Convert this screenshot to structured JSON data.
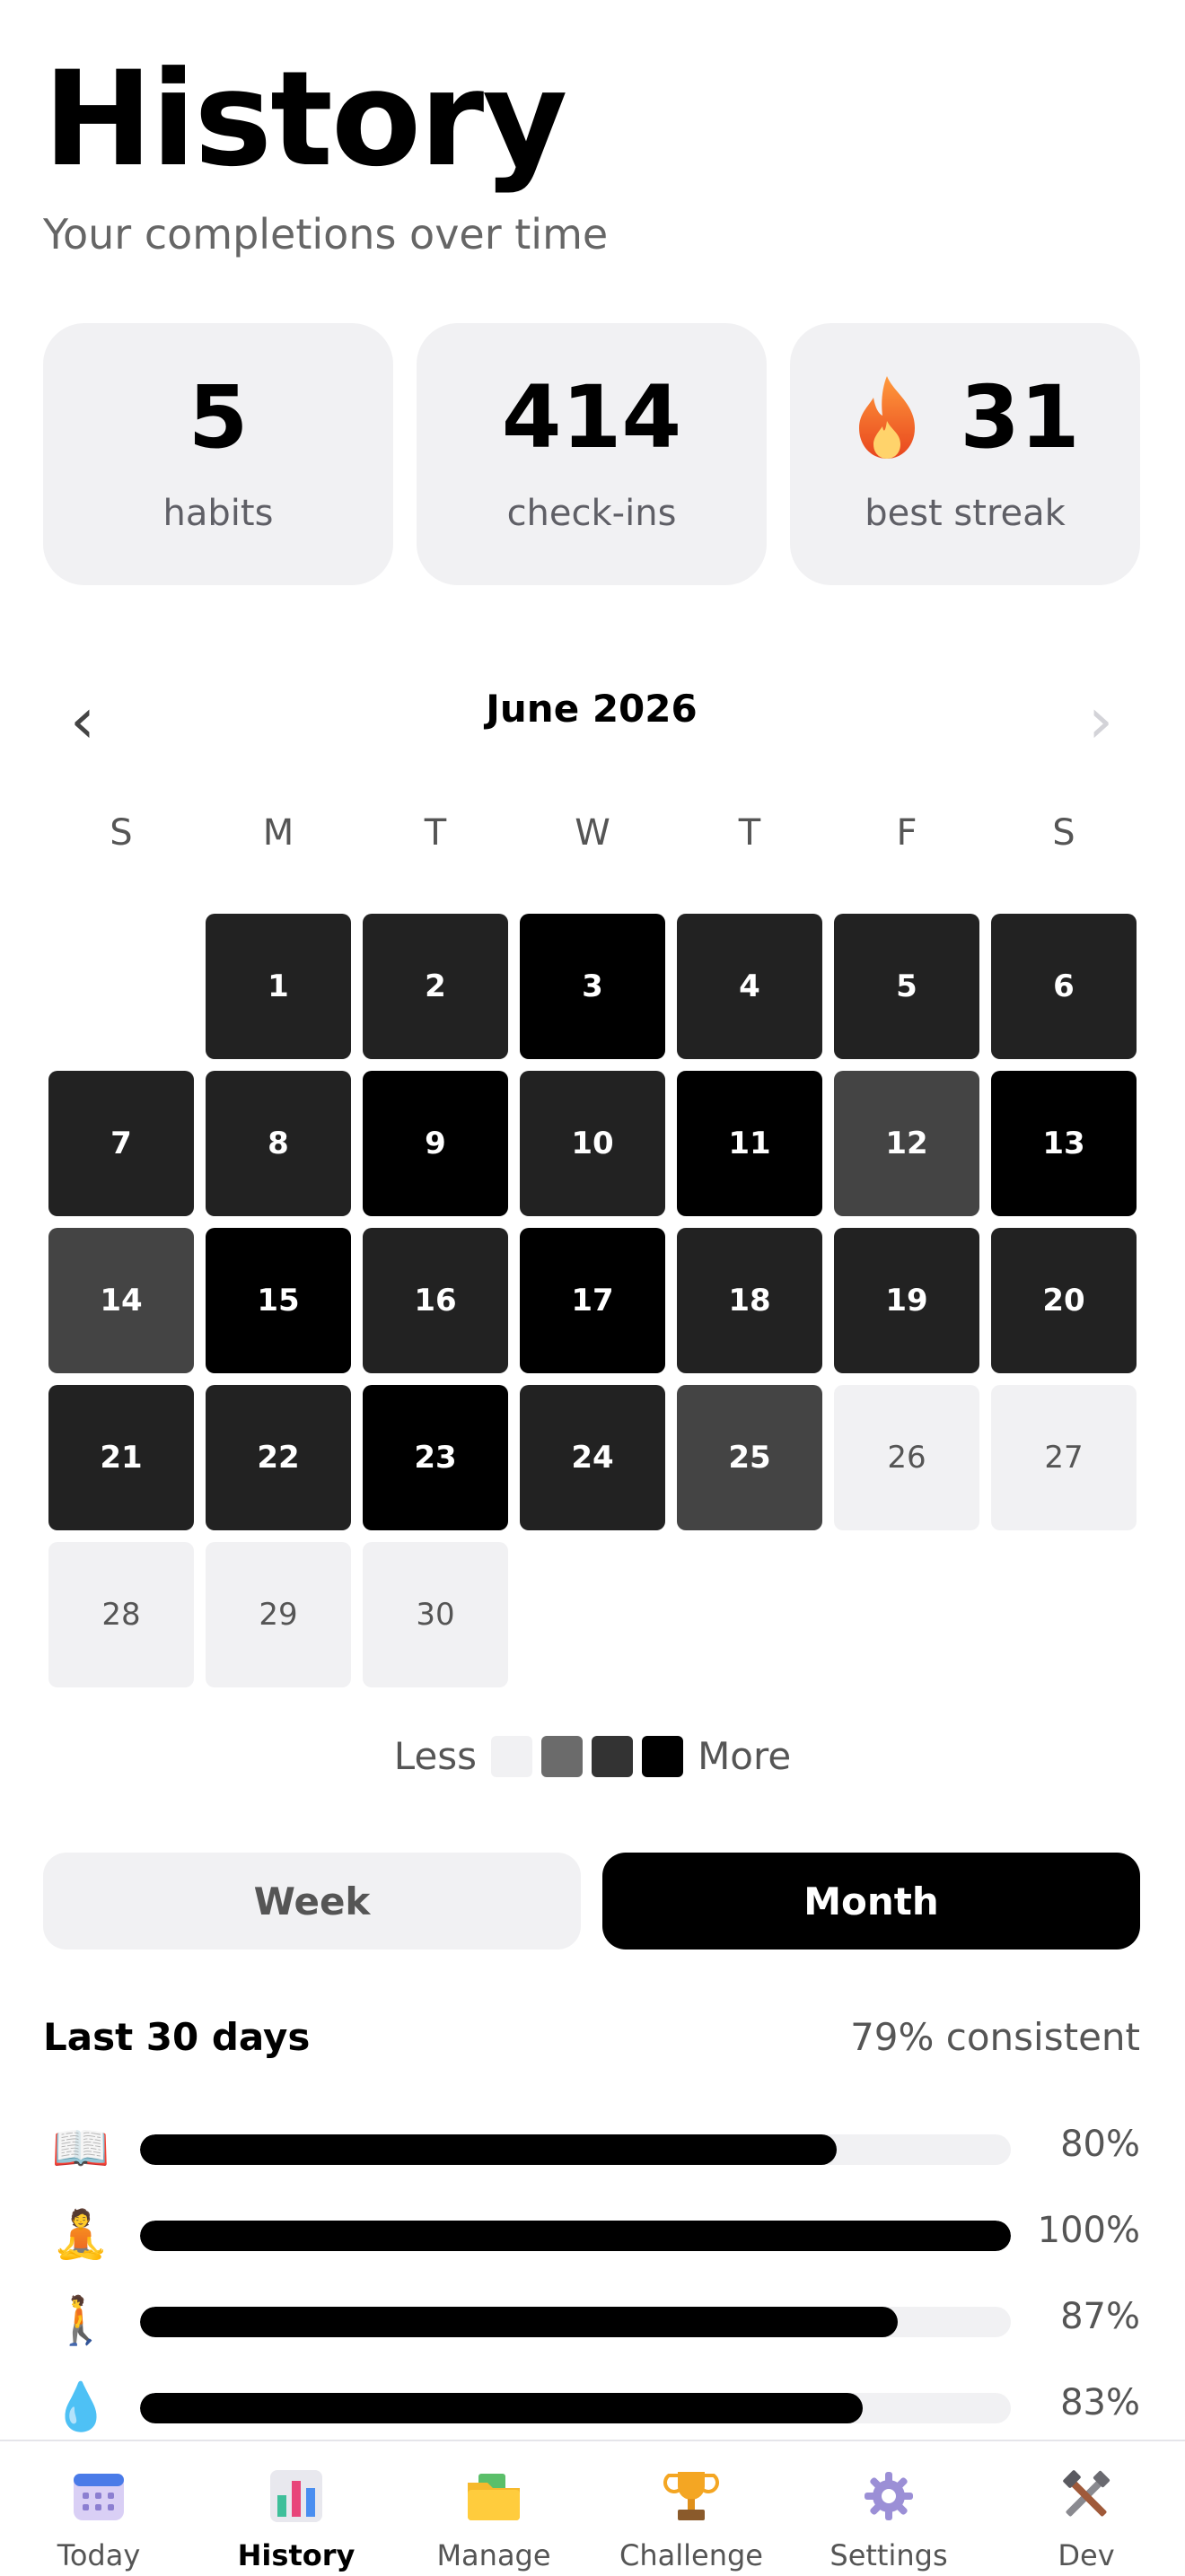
{
  "header": {
    "title": "History",
    "subtitle": "Your completions over time"
  },
  "stats": [
    {
      "value": "5",
      "label": "habits"
    },
    {
      "value": "414",
      "label": "check-ins"
    },
    {
      "value": "31",
      "label": "best streak",
      "icon": "flame-icon"
    }
  ],
  "calendar": {
    "month_label": "June 2026",
    "prev_icon": "‹",
    "next_icon": "›",
    "weekdays": [
      "S",
      "M",
      "T",
      "W",
      "T",
      "F",
      "S"
    ],
    "leading_blanks": 1,
    "days": [
      {
        "d": "1",
        "level": 2
      },
      {
        "d": "2",
        "level": 2
      },
      {
        "d": "3",
        "level": 3
      },
      {
        "d": "4",
        "level": 2
      },
      {
        "d": "5",
        "level": 2
      },
      {
        "d": "6",
        "level": 2
      },
      {
        "d": "7",
        "level": 2
      },
      {
        "d": "8",
        "level": 2
      },
      {
        "d": "9",
        "level": 3
      },
      {
        "d": "10",
        "level": 2
      },
      {
        "d": "11",
        "level": 3
      },
      {
        "d": "12",
        "level": 1
      },
      {
        "d": "13",
        "level": 3
      },
      {
        "d": "14",
        "level": 1
      },
      {
        "d": "15",
        "level": 3
      },
      {
        "d": "16",
        "level": 2
      },
      {
        "d": "17",
        "level": 3
      },
      {
        "d": "18",
        "level": 2
      },
      {
        "d": "19",
        "level": 2
      },
      {
        "d": "20",
        "level": 2
      },
      {
        "d": "21",
        "level": 2
      },
      {
        "d": "22",
        "level": 2
      },
      {
        "d": "23",
        "level": 3
      },
      {
        "d": "24",
        "level": 2
      },
      {
        "d": "25",
        "level": 1
      },
      {
        "d": "26",
        "level": 0
      },
      {
        "d": "27",
        "level": 0
      },
      {
        "d": "28",
        "level": 0
      },
      {
        "d": "29",
        "level": 0
      },
      {
        "d": "30",
        "level": 0
      }
    ],
    "colors": {
      "empty": "#f1f1f3",
      "low": "#444444",
      "mid": "#222222",
      "high": "#000000"
    }
  },
  "legend": {
    "less": "Less",
    "more": "More",
    "swatches": [
      "#f1f1f3",
      "#6b6b6b",
      "#333333",
      "#000000"
    ]
  },
  "range_toggle": {
    "week": "Week",
    "month": "Month",
    "selected": "Month"
  },
  "summary": {
    "title": "Last 30 days",
    "value": "79% consistent"
  },
  "habits": [
    {
      "icon": "📖",
      "icon_name": "book-icon",
      "percent": 80,
      "label": "80%"
    },
    {
      "icon": "🧘",
      "icon_name": "meditation-icon",
      "percent": 100,
      "label": "100%"
    },
    {
      "icon": "🚶",
      "icon_name": "walking-icon",
      "percent": 87,
      "label": "87%"
    },
    {
      "icon": "💧",
      "icon_name": "water-drop-icon",
      "percent": 83,
      "label": "83%"
    }
  ],
  "tabs": [
    {
      "label": "Today",
      "icon": "calendar-icon",
      "active": false
    },
    {
      "label": "History",
      "icon": "bar-chart-icon",
      "active": true
    },
    {
      "label": "Manage",
      "icon": "folder-icon",
      "active": false
    },
    {
      "label": "Challenge",
      "icon": "trophy-icon",
      "active": false
    },
    {
      "label": "Settings",
      "icon": "gear-icon",
      "active": false
    },
    {
      "label": "Dev",
      "icon": "tools-icon",
      "active": false
    }
  ]
}
